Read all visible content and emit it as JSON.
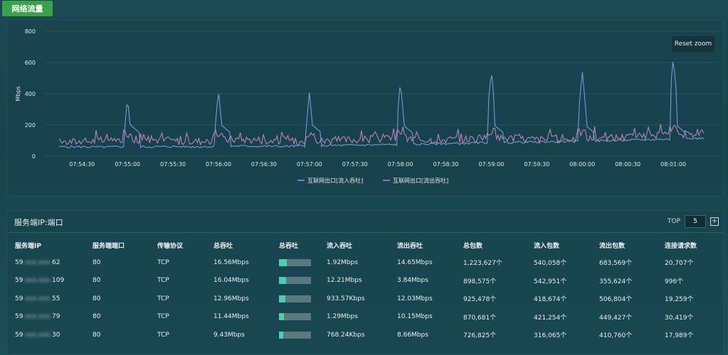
{
  "tab": {
    "label": "网络流量"
  },
  "chart": {
    "reset_zoom_label": "Reset zoom",
    "accent_colors": {
      "inbound": "#7c9ed6",
      "outbound": "#c883bb"
    }
  },
  "chart_data": {
    "type": "line",
    "title": "",
    "ylabel": "Mbps",
    "xlabel": "",
    "ylim": [
      0,
      800
    ],
    "yticks": [
      "0",
      "200",
      "400",
      "600",
      "800"
    ],
    "xticks": [
      "07:54:30",
      "07:55:00",
      "07:55:30",
      "07:56:00",
      "07:56:30",
      "07:57:00",
      "07:57:30",
      "07:58:00",
      "07:58:30",
      "07:59:00",
      "07:59:30",
      "08:00:00",
      "08:00:30",
      "08:01:00"
    ],
    "legend_position": "bottom",
    "series": [
      {
        "name": "互联网出口[流入吞吐]",
        "color": "#7c9ed6",
        "baseline": [
          60,
          60,
          58,
          62,
          60,
          62,
          60,
          62,
          65,
          64,
          63,
          65,
          68,
          70,
          72,
          74,
          76,
          80,
          82,
          85,
          88,
          90,
          92,
          95,
          98,
          100,
          104,
          108,
          110,
          115
        ],
        "spikes": [
          [
            "07:55:00",
            380
          ],
          [
            "07:56:00",
            425
          ],
          [
            "07:57:00",
            415
          ],
          [
            "07:58:00",
            480
          ],
          [
            "07:59:00",
            555
          ],
          [
            "08:00:00",
            545
          ],
          [
            "08:01:00",
            630
          ]
        ]
      },
      {
        "name": "互联网出口[流出吞吐]",
        "color": "#c883bb",
        "baseline": [
          90,
          95,
          100,
          105,
          110,
          100,
          95,
          100,
          110,
          105,
          100,
          95,
          100,
          105,
          110,
          115,
          110,
          105,
          110,
          115,
          120,
          110,
          105,
          110,
          115,
          120,
          125,
          130,
          140,
          150
        ],
        "spikes": []
      }
    ]
  },
  "table": {
    "title": "服务端IP:端口",
    "top_label": "TOP",
    "top_value": "5",
    "plus_label": "+",
    "headers": [
      "服务端IP",
      "服务端端口",
      "传输协议",
      "总吞吐",
      "总吞吐",
      "流入吞吐",
      "流出吞吐",
      "总包数",
      "流入包数",
      "流出包数",
      "连接请求数"
    ],
    "rows": [
      {
        "ip_prefix": "59",
        "ip_masked": ".xxx.xxx.",
        "ip_suffix": "62",
        "port": "80",
        "protocol": "TCP",
        "total": "16.56Mbps",
        "bar": 0.25,
        "inbound": "1.92Mbps",
        "outbound": "14.65Mbps",
        "packets": "1,223,627个",
        "in_packets": "540,058个",
        "out_packets": "683,569个",
        "connections": "20,707个"
      },
      {
        "ip_prefix": "59",
        "ip_masked": ".xxx.xxx.",
        "ip_suffix": "109",
        "port": "80",
        "protocol": "TCP",
        "total": "16.04Mbps",
        "bar": 0.22,
        "inbound": "12.21Mbps",
        "outbound": "3.84Mbps",
        "packets": "898,575个",
        "in_packets": "542,951个",
        "out_packets": "355,624个",
        "connections": "996个"
      },
      {
        "ip_prefix": "59",
        "ip_masked": ".xxx.xxx.",
        "ip_suffix": "55",
        "port": "80",
        "protocol": "TCP",
        "total": "12.96Mbps",
        "bar": 0.2,
        "inbound": "933.57Kbps",
        "outbound": "12.03Mbps",
        "packets": "925,478个",
        "in_packets": "418,674个",
        "out_packets": "506,804个",
        "connections": "19,259个"
      },
      {
        "ip_prefix": "59",
        "ip_masked": ".xxx.xxx.",
        "ip_suffix": "79",
        "port": "80",
        "protocol": "TCP",
        "total": "11.44Mbps",
        "bar": 0.16,
        "inbound": "1.29Mbps",
        "outbound": "10.15Mbps",
        "packets": "870,681个",
        "in_packets": "421,254个",
        "out_packets": "449,427个",
        "connections": "30,419个"
      },
      {
        "ip_prefix": "59",
        "ip_masked": ".xxx.xxx.",
        "ip_suffix": "30",
        "port": "80",
        "protocol": "TCP",
        "total": "9.43Mbps",
        "bar": 0.13,
        "inbound": "768.24Kbps",
        "outbound": "8.66Mbps",
        "packets": "726,825个",
        "in_packets": "316,065个",
        "out_packets": "410,760个",
        "connections": "17,989个"
      }
    ]
  }
}
